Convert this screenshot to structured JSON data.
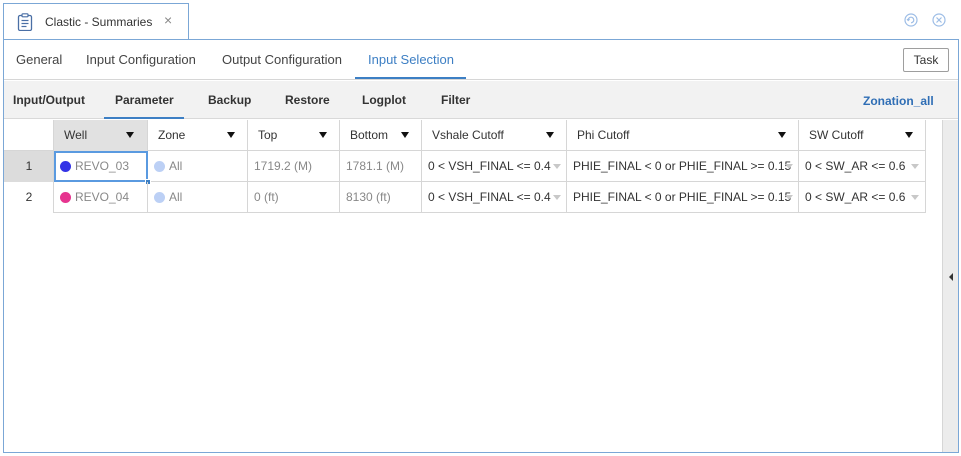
{
  "window": {
    "tab_title": "Clastic - Summaries",
    "close_glyph": "×"
  },
  "main_tabs": [
    {
      "label": "General",
      "active": false
    },
    {
      "label": "Input Configuration",
      "active": false
    },
    {
      "label": "Output Configuration",
      "active": false
    },
    {
      "label": "Input Selection",
      "active": true
    }
  ],
  "task_button": "Task",
  "sub_tabs": [
    {
      "label": "Input/Output",
      "active": false
    },
    {
      "label": "Parameter",
      "active": true
    },
    {
      "label": "Backup",
      "active": false
    },
    {
      "label": "Restore",
      "active": false
    },
    {
      "label": "Logplot",
      "active": false
    },
    {
      "label": "Filter",
      "active": false
    }
  ],
  "zonation_link": "Zonation_all",
  "grid": {
    "columns": [
      "Well",
      "Zone",
      "Top",
      "Bottom",
      "Vshale Cutoff",
      "Phi Cutoff",
      "SW Cutoff"
    ],
    "rows": [
      {
        "num": "1",
        "well": "REVO_03",
        "well_color": "#3333e6",
        "zone": "All",
        "zone_color": "#bcd0f5",
        "top": "1719.2 (M)",
        "bottom": "1781.1 (M)",
        "vshale": "0 < VSH_FINAL <= 0.4",
        "phi": "PHIE_FINAL < 0 or PHIE_FINAL >= 0.15",
        "sw": "0 < SW_AR <= 0.6"
      },
      {
        "num": "2",
        "well": "REVO_04",
        "well_color": "#e6348f",
        "zone": "All",
        "zone_color": "#bcd0f5",
        "top": "0 (ft)",
        "bottom": "8130 (ft)",
        "vshale": "0 < VSH_FINAL <= 0.4",
        "phi": "PHIE_FINAL < 0 or PHIE_FINAL >= 0.15",
        "sw": "0 < SW_AR <= 0.6"
      }
    ]
  },
  "icons": {
    "doc": "clipboard-icon",
    "refresh": "refresh-icon",
    "close": "close-circle-icon",
    "collapse": "collapse-left-icon"
  }
}
